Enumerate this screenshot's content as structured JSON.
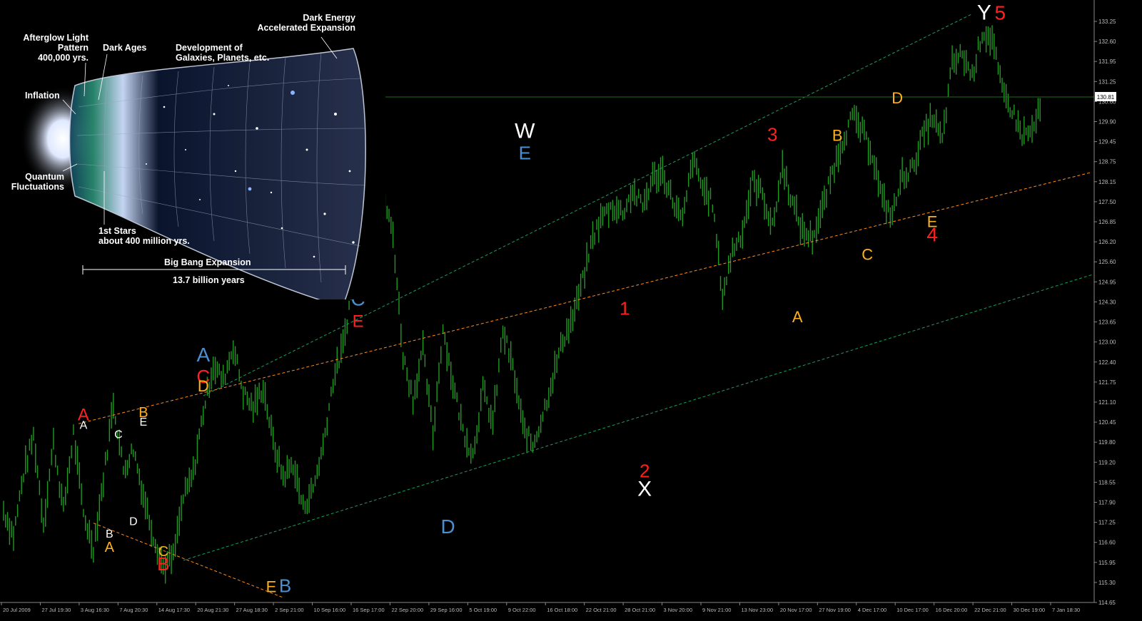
{
  "chart_data": {
    "type": "line",
    "instrument_note": "",
    "y_axis": {
      "ticks": [
        "133.25",
        "132.60",
        "131.95",
        "131.25",
        "130.60",
        "129.90",
        "129.45",
        "128.75",
        "128.15",
        "127.50",
        "126.85",
        "126.20",
        "125.60",
        "124.95",
        "124.30",
        "123.65",
        "123.00",
        "122.40",
        "121.75",
        "121.10",
        "120.45",
        "119.80",
        "119.20",
        "118.55",
        "117.90",
        "117.25",
        "116.60",
        "115.95",
        "115.30",
        "114.65"
      ],
      "range": [
        114.65,
        133.25
      ],
      "current_price": "130.81"
    },
    "x_axis": {
      "ticks": [
        "20 Jul 2009",
        "27 Jul 19:30",
        "3 Aug 16:30",
        "7 Aug 20:30",
        "14 Aug 17:30",
        "20 Aug 21:30",
        "27 Aug 18:30",
        "2 Sep 21:00",
        "10 Sep 16:00",
        "16 Sep 17:00",
        "22 Sep 20:00",
        "29 Sep 16:00",
        "5 Oct 19:00",
        "9 Oct 22:00",
        "16 Oct 18:00",
        "22 Oct 21:00",
        "28 Oct 21:00",
        "3 Nov 20:00",
        "9 Nov 21:00",
        "13 Nov 23:00",
        "20 Nov 17:00",
        "27 Nov 19:00",
        "4 Dec 17:00",
        "10 Dec 17:00",
        "16 Dec 20:00",
        "22 Dec 21:00",
        "30 Dec 19:00",
        "7 Jan 18:30"
      ]
    },
    "series": [
      {
        "color": "#1f9a1f",
        "points": [
          [
            0,
            117.4
          ],
          [
            1,
            116.6
          ],
          [
            2,
            118.6
          ],
          [
            3,
            119.8
          ],
          [
            4,
            117.0
          ],
          [
            5,
            119.6
          ],
          [
            6,
            117.4
          ],
          [
            7,
            119.9
          ],
          [
            8,
            117.3
          ],
          [
            9,
            116.2
          ],
          [
            10,
            118.4
          ],
          [
            11,
            120.9
          ],
          [
            12,
            118.7
          ],
          [
            13,
            119.4
          ],
          [
            14,
            117.9
          ],
          [
            15,
            116.6
          ],
          [
            16,
            115.6
          ],
          [
            17,
            115.9
          ],
          [
            18,
            117.8
          ],
          [
            19,
            118.6
          ],
          [
            20,
            120.6
          ],
          [
            21,
            122.1
          ],
          [
            22,
            121.6
          ],
          [
            23,
            122.7
          ],
          [
            24,
            121.2
          ],
          [
            25,
            120.7
          ],
          [
            26,
            121.4
          ],
          [
            27,
            119.6
          ],
          [
            28,
            118.5
          ],
          [
            29,
            118.9
          ],
          [
            30,
            117.5
          ],
          [
            31,
            118.1
          ],
          [
            32,
            119.5
          ],
          [
            33,
            121.6
          ],
          [
            34,
            122.7
          ],
          [
            35,
            124.8
          ],
          [
            36,
            126.0
          ],
          [
            37,
            127.0
          ],
          [
            38,
            127.5
          ],
          [
            39,
            126.3
          ],
          [
            40,
            122.4
          ],
          [
            41,
            121.0
          ],
          [
            42,
            122.6
          ],
          [
            43,
            119.8
          ],
          [
            44,
            123.3
          ],
          [
            45,
            121.5
          ],
          [
            46,
            120.0
          ],
          [
            47,
            119.2
          ],
          [
            48,
            121.3
          ],
          [
            49,
            120.2
          ],
          [
            50,
            123.2
          ],
          [
            51,
            122.0
          ],
          [
            52,
            120.1
          ],
          [
            53,
            119.5
          ],
          [
            54,
            120.5
          ],
          [
            55,
            121.7
          ],
          [
            56,
            122.9
          ],
          [
            57,
            123.6
          ],
          [
            58,
            124.8
          ],
          [
            59,
            126.2
          ],
          [
            60,
            126.9
          ],
          [
            61,
            127.2
          ],
          [
            62,
            127.0
          ],
          [
            63,
            127.7
          ],
          [
            64,
            127.2
          ],
          [
            65,
            128.1
          ],
          [
            66,
            128.3
          ],
          [
            67,
            127.4
          ],
          [
            68,
            126.7
          ],
          [
            69,
            128.7
          ],
          [
            70,
            127.8
          ],
          [
            71,
            127.3
          ],
          [
            72,
            124.3
          ],
          [
            73,
            125.8
          ],
          [
            74,
            126.4
          ],
          [
            75,
            128.0
          ],
          [
            76,
            127.6
          ],
          [
            77,
            126.5
          ],
          [
            78,
            128.5
          ],
          [
            79,
            127.3
          ],
          [
            80,
            126.4
          ],
          [
            81,
            126.2
          ],
          [
            82,
            127.1
          ],
          [
            83,
            128.3
          ],
          [
            84,
            129.3
          ],
          [
            85,
            130.1
          ],
          [
            86,
            129.6
          ],
          [
            87,
            128.9
          ],
          [
            88,
            127.4
          ],
          [
            89,
            126.9
          ],
          [
            90,
            128.2
          ],
          [
            91,
            128.4
          ],
          [
            92,
            129.4
          ],
          [
            93,
            130.1
          ],
          [
            94,
            129.3
          ],
          [
            95,
            131.8
          ],
          [
            96,
            132.1
          ],
          [
            97,
            131.4
          ],
          [
            98,
            132.8
          ],
          [
            99,
            132.6
          ],
          [
            100,
            130.9
          ],
          [
            101,
            130.3
          ],
          [
            102,
            129.5
          ],
          [
            103,
            129.6
          ],
          [
            104,
            130.5
          ]
        ]
      }
    ],
    "trendlines": [
      {
        "color": "#ff8c1a",
        "style": "dashed",
        "from": [
          9,
          117.0
        ],
        "to": [
          28,
          114.6
        ]
      },
      {
        "color": "#ff8c1a",
        "style": "dashed",
        "from": [
          7.5,
          120.2
        ],
        "to": [
          109,
          128.3
        ]
      },
      {
        "color": "#19a05a",
        "style": "dashed",
        "from": [
          18,
          115.8
        ],
        "to": [
          109,
          125.0
        ]
      },
      {
        "color": "#19a05a",
        "style": "dashed",
        "from": [
          20,
          121.1
        ],
        "to": [
          97,
          133.4
        ]
      }
    ],
    "wave_labels": [
      {
        "text": "A",
        "color": "#ff2020",
        "x": 8,
        "y": 119.9,
        "pos": "above",
        "size": 24
      },
      {
        "text": "A",
        "color": "#ffffff",
        "x": 8,
        "y": 119.9,
        "pos": "above-small",
        "size": 16
      },
      {
        "text": "C",
        "color": "#ffffff",
        "x": 11.5,
        "y": 119.6,
        "pos": "above-small",
        "size": 16
      },
      {
        "text": "B",
        "color": "#ffb020",
        "x": 14,
        "y": 120.0,
        "pos": "above",
        "size": 20
      },
      {
        "text": "E",
        "color": "#ffffff",
        "x": 14,
        "y": 120.0,
        "pos": "above-small",
        "size": 16
      },
      {
        "text": "B",
        "color": "#ffffff",
        "x": 10.6,
        "y": 116.9,
        "pos": "below-small",
        "size": 16
      },
      {
        "text": "A",
        "color": "#ffb020",
        "x": 10.6,
        "y": 116.9,
        "pos": "below",
        "size": 20
      },
      {
        "text": "D",
        "color": "#ffffff",
        "x": 13,
        "y": 117.3,
        "pos": "below-small",
        "size": 16
      },
      {
        "text": "C",
        "color": "#ffb020",
        "x": 16,
        "y": 116.3,
        "pos": "below-small",
        "size": 20
      },
      {
        "text": "B",
        "color": "#ff2020",
        "x": 16,
        "y": 116.3,
        "pos": "below",
        "size": 26
      },
      {
        "text": "A",
        "color": "#4a8fd0",
        "x": 20,
        "y": 121.1,
        "pos": "above-top",
        "size": 28
      },
      {
        "text": "C",
        "color": "#ff2020",
        "x": 20,
        "y": 121.1,
        "pos": "above",
        "size": 26
      },
      {
        "text": "D",
        "color": "#ffb020",
        "x": 20,
        "y": 121.1,
        "pos": "above-small",
        "size": 22
      },
      {
        "text": "E",
        "color": "#ffb020",
        "x": 26.8,
        "y": 115.6,
        "pos": "below",
        "size": 22
      },
      {
        "text": "B",
        "color": "#4a8fd0",
        "x": 28.2,
        "y": 115.6,
        "pos": "below",
        "size": 26
      },
      {
        "text": "C",
        "color": "#4a8fd0",
        "x": 35.5,
        "y": 122.9,
        "pos": "above-top",
        "size": 28
      },
      {
        "text": "E",
        "color": "#ff2020",
        "x": 35.5,
        "y": 122.9,
        "pos": "above",
        "size": 24
      },
      {
        "text": "D",
        "color": "#4a8fd0",
        "x": 44.5,
        "y": 117.5,
        "pos": "below",
        "size": 28
      },
      {
        "text": "W",
        "color": "#ffffff",
        "x": 52.2,
        "y": 128.3,
        "pos": "above-top",
        "size": 30
      },
      {
        "text": "E",
        "color": "#4a8fd0",
        "x": 52.2,
        "y": 128.3,
        "pos": "above",
        "size": 26
      },
      {
        "text": "1",
        "color": "#ff2020",
        "x": 62.2,
        "y": 123.3,
        "pos": "above",
        "size": 26
      },
      {
        "text": "2",
        "color": "#ff2020",
        "x": 64.2,
        "y": 119.3,
        "pos": "below",
        "size": 26
      },
      {
        "text": "X",
        "color": "#ffffff",
        "x": 64.2,
        "y": 119.3,
        "pos": "below-top",
        "size": 30
      },
      {
        "text": "3",
        "color": "#ff2020",
        "x": 77,
        "y": 128.9,
        "pos": "above",
        "size": 26
      },
      {
        "text": "A",
        "color": "#ffb020",
        "x": 79.5,
        "y": 124.3,
        "pos": "below",
        "size": 22
      },
      {
        "text": "B",
        "color": "#ffb020",
        "x": 83.5,
        "y": 128.9,
        "pos": "above",
        "size": 22
      },
      {
        "text": "C",
        "color": "#ffb020",
        "x": 86.5,
        "y": 126.3,
        "pos": "below",
        "size": 22
      },
      {
        "text": "D",
        "color": "#ffb020",
        "x": 89.5,
        "y": 130.1,
        "pos": "above",
        "size": 22
      },
      {
        "text": "E",
        "color": "#ffb020",
        "x": 93,
        "y": 126.9,
        "pos": "below-small",
        "size": 22
      },
      {
        "text": "4",
        "color": "#ff2020",
        "x": 93,
        "y": 126.9,
        "pos": "below",
        "size": 28
      },
      {
        "text": "Y",
        "color": "#ffffff",
        "x": 98.2,
        "y": 132.8,
        "pos": "above",
        "size": 30
      },
      {
        "text": "5",
        "color": "#ff2020",
        "x": 99.8,
        "y": 132.8,
        "pos": "above",
        "size": 28
      }
    ]
  },
  "inset": {
    "labels": {
      "afterglow": "Afterglow Light\nPattern\n400,000 yrs.",
      "dark_ages": "Dark Ages",
      "development": "Development of\nGalaxies, Planets, etc.",
      "dark_energy": "Dark Energy\nAccelerated Expansion",
      "inflation": "Inflation",
      "quantum": "Quantum\nFluctuations",
      "first_stars": "1st Stars\nabout 400 million yrs.",
      "big_bang": "Big Bang Expansion",
      "duration": "13.7 billion years"
    }
  }
}
